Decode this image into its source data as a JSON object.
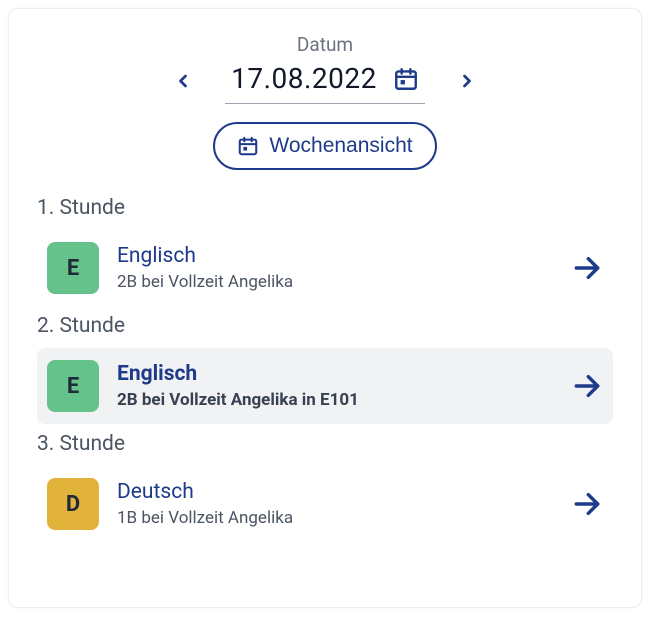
{
  "header": {
    "label": "Datum",
    "date": "17.08.2022",
    "week_view_label": "Wochenansicht"
  },
  "periods": [
    {
      "label": "1. Stunde",
      "lesson": {
        "badge_letter": "E",
        "badge_color": "green",
        "title": "Englisch",
        "subtitle": "2B bei Vollzeit Angelika",
        "highlight": false
      }
    },
    {
      "label": "2. Stunde",
      "lesson": {
        "badge_letter": "E",
        "badge_color": "green",
        "title": "Englisch",
        "subtitle": "2B bei Vollzeit Angelika in E101",
        "highlight": true
      }
    },
    {
      "label": "3. Stunde",
      "lesson": {
        "badge_letter": "D",
        "badge_color": "yellow",
        "title": "Deutsch",
        "subtitle": "1B bei Vollzeit Angelika",
        "highlight": false
      }
    }
  ]
}
